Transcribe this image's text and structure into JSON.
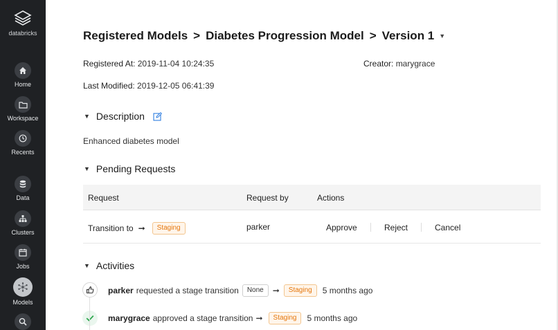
{
  "sidebar": {
    "logo_label": "databricks",
    "items": [
      {
        "label": "Home",
        "icon": "home-icon"
      },
      {
        "label": "Workspace",
        "icon": "folder-icon"
      },
      {
        "label": "Recents",
        "icon": "clock-icon"
      },
      {
        "label": "Data",
        "icon": "database-icon"
      },
      {
        "label": "Clusters",
        "icon": "cluster-icon"
      },
      {
        "label": "Jobs",
        "icon": "calendar-icon"
      },
      {
        "label": "Models",
        "icon": "models-icon",
        "active": true
      },
      {
        "label": "",
        "icon": "search-icon"
      }
    ]
  },
  "breadcrumb": {
    "root": "Registered Models",
    "separator": ">",
    "model": "Diabetes Progression Model",
    "version": "Version 1"
  },
  "meta": {
    "registered_at_label": "Registered At",
    "registered_at_value": "2019-11-04 10:24:35",
    "creator_label": "Creator",
    "creator_value": "marygrace",
    "last_modified_label": "Last Modified",
    "last_modified_value": "2019-12-05 06:41:39"
  },
  "description": {
    "heading": "Description",
    "text": "Enhanced diabetes model"
  },
  "pending": {
    "heading": "Pending Requests",
    "columns": [
      "Request",
      "Request by",
      "Actions"
    ],
    "rows": [
      {
        "request_text": "Transition to",
        "arrow": "➞",
        "stage": "Staging",
        "request_by": "parker",
        "actions": [
          "Approve",
          "Reject",
          "Cancel"
        ]
      }
    ]
  },
  "activities": {
    "heading": "Activities",
    "items": [
      {
        "user": "parker",
        "text": "requested a stage transition",
        "from": "None",
        "arrow": "➞",
        "to": "Staging",
        "when": "5 months ago"
      },
      {
        "user": "marygrace",
        "text": "approved a stage transition",
        "arrow": "➞",
        "to": "Staging",
        "when": "5 months ago"
      }
    ]
  },
  "colors": {
    "sidebar_bg": "#1f2124",
    "link": "#2d7de0",
    "staging_badge": "#e5760b",
    "approved_check": "#2fa84f"
  }
}
